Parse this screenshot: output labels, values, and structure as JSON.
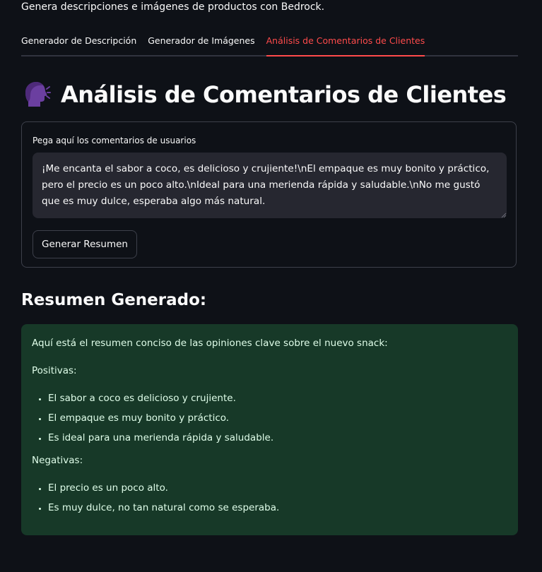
{
  "header": {
    "subtitle": "Genera descripciones e imágenes de productos con Bedrock."
  },
  "tabs": [
    {
      "label": "Generador de Descripción",
      "active": false
    },
    {
      "label": "Generador de Imágenes",
      "active": false
    },
    {
      "label": "Análisis de Comentarios de Clientes",
      "active": true
    }
  ],
  "page": {
    "title": "Análisis de Comentarios de Clientes",
    "title_icon": "speaking-head-icon"
  },
  "form": {
    "textarea_label": "Pega aquí los comentarios de usuarios",
    "textarea_value": "¡Me encanta el sabor a coco, es delicioso y crujiente!\\nEl empaque es muy bonito y práctico, pero el precio es un poco alto.\\nIdeal para una merienda rápida y saludable.\\nNo me gustó que es muy dulce, esperaba algo más natural.",
    "button_label": "Generar Resumen"
  },
  "result": {
    "heading": "Resumen Generado:",
    "intro": "Aquí está el resumen conciso de las opiniones clave sobre el nuevo snack:",
    "positive_label": "Positivas:",
    "positive_items": [
      "El sabor a coco es delicioso y crujiente.",
      "El empaque es muy bonito y práctico.",
      "Es ideal para una merienda rápida y saludable."
    ],
    "negative_label": "Negativas:",
    "negative_items": [
      "El precio es un poco alto.",
      "Es muy dulce, no tan natural como se esperaba."
    ]
  },
  "colors": {
    "background": "#0e1117",
    "accent": "#ff4b4b",
    "success_bg": "#173928",
    "success_text": "#dffde9",
    "input_bg": "#262730"
  }
}
